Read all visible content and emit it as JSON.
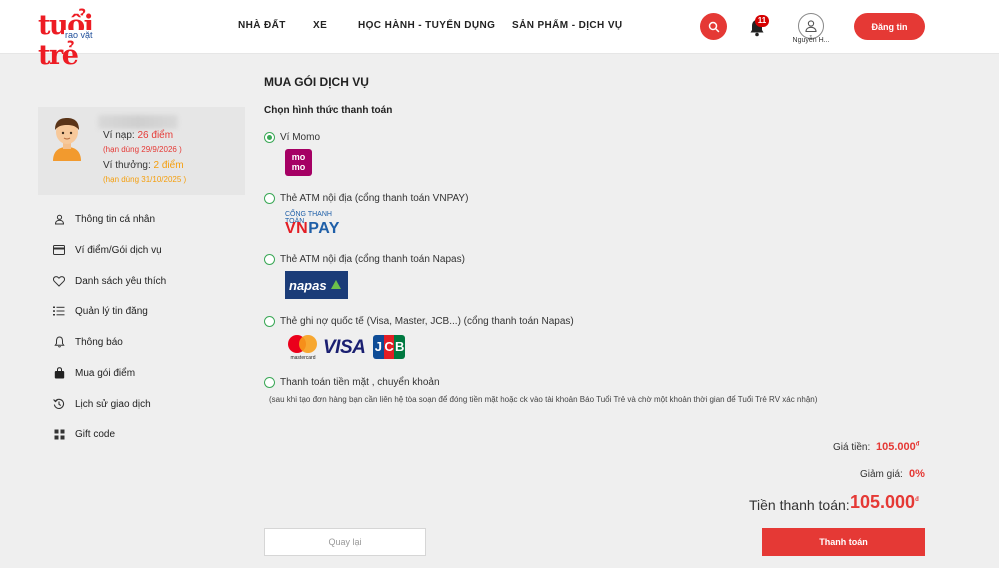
{
  "header": {
    "logo_main": "tuổi trẻ",
    "logo_sub": "rao vặt",
    "nav": [
      "NHÀ ĐẤT",
      "XE",
      "HỌC HÀNH - TUYỂN DỤNG",
      "SẢN PHẨM - DỊCH VỤ"
    ],
    "notification_count": "11",
    "user_name": "Nguyễn H...",
    "post_button": "Đăng tin"
  },
  "sidebar": {
    "wallet": {
      "deposit_label": "Ví nạp:",
      "deposit_value": "26 điểm",
      "deposit_expiry": "(hạn dùng 29/9/2026 )",
      "bonus_label": "Ví thưởng:",
      "bonus_value": "2 điểm",
      "bonus_expiry": "(hạn dùng 31/10/2025 )"
    },
    "menu": [
      {
        "label": "Thông tin cá nhân",
        "icon": "person-icon"
      },
      {
        "label": "Ví điểm/Gói dịch vụ",
        "icon": "card-icon"
      },
      {
        "label": "Danh sách yêu thích",
        "icon": "heart-icon"
      },
      {
        "label": "Quản lý tin đăng",
        "icon": "list-icon"
      },
      {
        "label": "Thông báo",
        "icon": "bell-icon"
      },
      {
        "label": "Mua gói điểm",
        "icon": "bag-icon"
      },
      {
        "label": "Lịch sử giao dịch",
        "icon": "history-icon"
      },
      {
        "label": "Gift code",
        "icon": "grid-icon"
      }
    ]
  },
  "main": {
    "title": "MUA GÓI DỊCH VỤ",
    "section_title": "Chọn hình thức thanh toán",
    "payment_options": [
      {
        "label": "Ví Momo",
        "selected": true
      },
      {
        "label": "Thẻ ATM nội địa (cổng thanh toán VNPAY)",
        "selected": false
      },
      {
        "label": "Thẻ ATM nội địa (cổng thanh toán Napas)",
        "selected": false
      },
      {
        "label": "Thẻ ghi nợ quốc tế (Visa, Master, JCB...) (cổng thanh toán Napas)",
        "selected": false
      },
      {
        "label": "Thanh toán tiền mặt , chuyển khoản",
        "selected": false
      }
    ],
    "logos": {
      "momo": "mo\nmo",
      "vnpay_caption": "CỔNG THANH TOÁN",
      "vnpay": "VNPAY",
      "napas": "napas",
      "mastercard": "mastercard",
      "visa": "VISA",
      "jcb": "JCB"
    },
    "cash_note": "(sau khi tạo đơn hàng bạn cần liên hệ tòa soạn để đóng tiền mặt hoặc ck vào tài khoản Báo Tuổi Trẻ và chờ một khoản thời gian để Tuổi Trẻ RV xác nhận)",
    "summary": {
      "price_label": "Giá tiền:",
      "price_value": "105.000",
      "discount_label": "Giảm giá:",
      "discount_value": "0%",
      "total_label": "Tiền thanh toán:",
      "total_value": "105.000",
      "currency": "đ"
    },
    "back_button": "Quay lại",
    "pay_button": "Thanh toán"
  },
  "colors": {
    "brand_red": "#e53935",
    "radio_green": "#3aa856",
    "momo_purple": "#a50064",
    "napas_blue": "#1b3c78"
  }
}
